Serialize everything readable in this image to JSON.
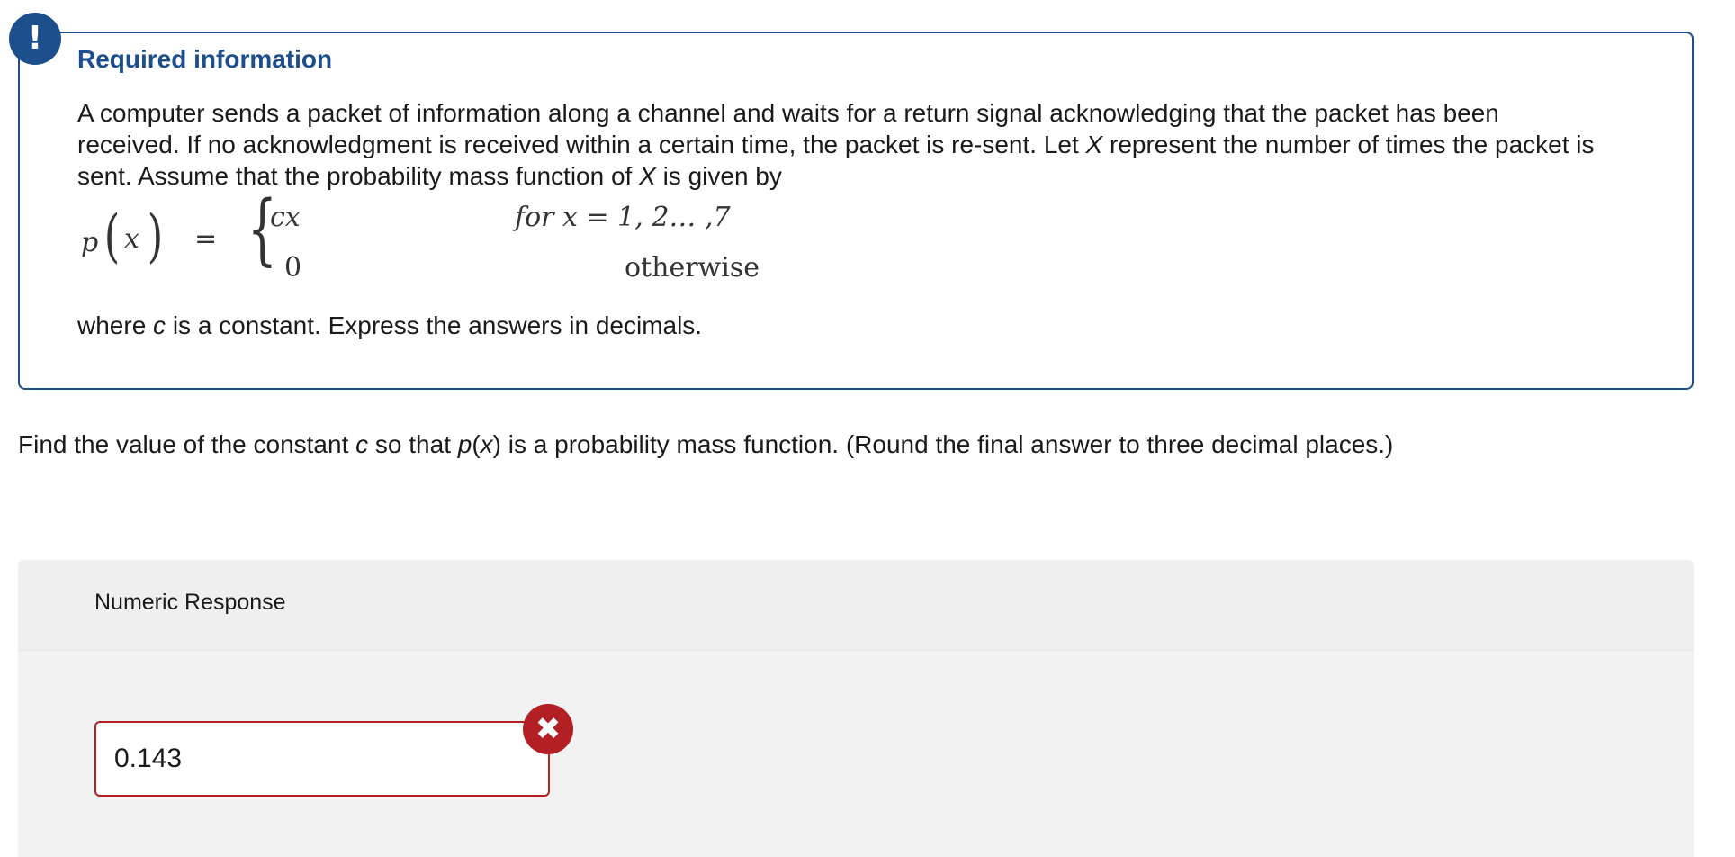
{
  "alert": {
    "icon": "exclamation-icon",
    "badge_text": "!",
    "color": "#1c4f8c"
  },
  "info": {
    "title": "Required information",
    "text_part1": "A computer sends a packet of information along a channel and waits for a return signal acknowledging that the packet has been received. If no acknowledgment is received within a certain time, the packet is re-sent. Let ",
    "var_X1": "X",
    "text_part2": " represent the number of times the packet is sent. Assume that the probability mass function of ",
    "var_X2": "X",
    "text_part3": " is given by",
    "formula": {
      "p": "p",
      "lparen": "(",
      "x": "x",
      "rparen": ")",
      "equals": "=",
      "brace": "{",
      "case1_value": "cx",
      "case1_condition": "for x = 1, 2… ,7",
      "case2_value": "0",
      "case2_condition": "otherwise"
    },
    "tail_part1": "where ",
    "tail_var_c": "c",
    "tail_part2": " is a constant. Express the answers in decimals."
  },
  "question": {
    "part1": "Find the value of the constant ",
    "var_c": "c",
    "part2": " so that ",
    "var_p": "p",
    "paren_open": "(",
    "var_x": "x",
    "paren_close": ")",
    "part3": " is a probability mass function. (Round the final answer to three decimal places.)"
  },
  "response": {
    "label": "Numeric Response",
    "answer_value": "0.143",
    "status": "incorrect",
    "status_icon": "close-icon",
    "status_glyph": "✖",
    "error_color": "#b21f24"
  }
}
